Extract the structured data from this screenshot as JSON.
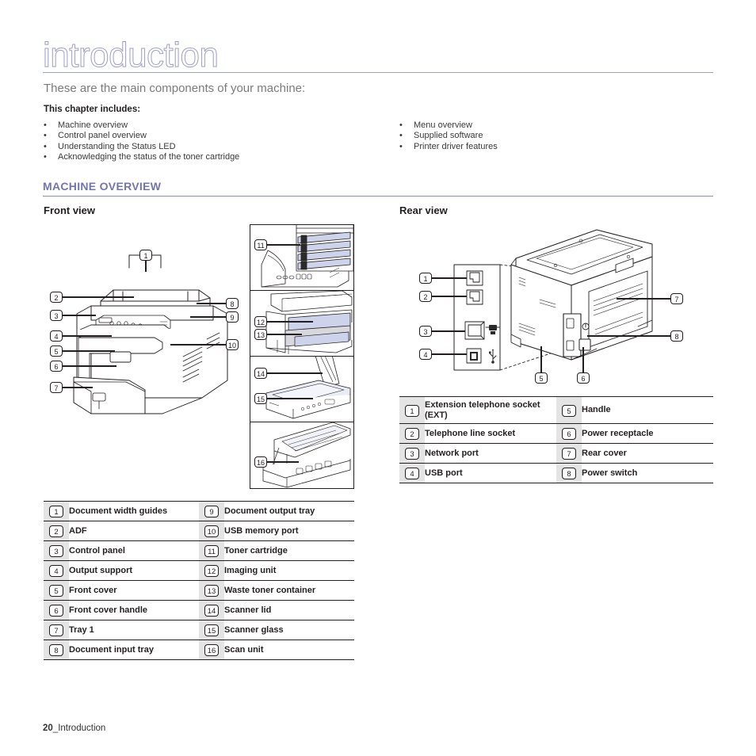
{
  "document": {
    "chapter_title": "introduction",
    "intro_line": "These are the main components of your machine:",
    "chapter_includes_label": "This chapter includes:",
    "accent_color": "#7275ad",
    "title_outline_color": "#9d9fc6"
  },
  "toc": {
    "bullet_glyph": "•",
    "left": [
      "Machine overview",
      "Control panel overview",
      "Understanding the Status LED",
      "Acknowledging the status of the toner cartridge"
    ],
    "right": [
      "Menu overview",
      "Supplied software",
      "Printer driver features"
    ]
  },
  "section": {
    "heading": "MACHINE OVERVIEW",
    "front_subheading": "Front view",
    "rear_subheading": "Rear view"
  },
  "front_view": {
    "diagram_callouts": [
      "1",
      "2",
      "3",
      "4",
      "5",
      "6",
      "7",
      "8",
      "9",
      "10"
    ],
    "inset_callouts": [
      "11",
      "12",
      "13",
      "14",
      "15",
      "16"
    ],
    "table_left": [
      {
        "num": "1",
        "label": "Document width guides"
      },
      {
        "num": "2",
        "label": "ADF"
      },
      {
        "num": "3",
        "label": "Control panel"
      },
      {
        "num": "4",
        "label": "Output support"
      },
      {
        "num": "5",
        "label": "Front cover"
      },
      {
        "num": "6",
        "label": "Front cover handle"
      },
      {
        "num": "7",
        "label": "Tray 1"
      },
      {
        "num": "8",
        "label": "Document input tray"
      }
    ],
    "table_right": [
      {
        "num": "9",
        "label": "Document output tray"
      },
      {
        "num": "10",
        "label": "USB memory port"
      },
      {
        "num": "11",
        "label": "Toner cartridge"
      },
      {
        "num": "12",
        "label": "Imaging unit"
      },
      {
        "num": "13",
        "label": "Waste toner container"
      },
      {
        "num": "14",
        "label": "Scanner lid"
      },
      {
        "num": "15",
        "label": "Scanner glass"
      },
      {
        "num": "16",
        "label": "Scan unit"
      }
    ]
  },
  "rear_view": {
    "diagram_callouts": [
      "1",
      "2",
      "3",
      "4",
      "5",
      "6",
      "7",
      "8"
    ],
    "port_icons": [
      "network-port-icon",
      "usb-port-icon"
    ],
    "table_left": [
      {
        "num": "1",
        "label": "Extension telephone socket (EXT)"
      },
      {
        "num": "2",
        "label": "Telephone line socket"
      },
      {
        "num": "3",
        "label": "Network port"
      },
      {
        "num": "4",
        "label": "USB port"
      }
    ],
    "table_right": [
      {
        "num": "5",
        "label": "Handle"
      },
      {
        "num": "6",
        "label": "Power receptacle"
      },
      {
        "num": "7",
        "label": "Rear cover"
      },
      {
        "num": "8",
        "label": "Power switch"
      }
    ]
  },
  "footer": {
    "page_number": "20",
    "page_label": "_Introduction"
  }
}
